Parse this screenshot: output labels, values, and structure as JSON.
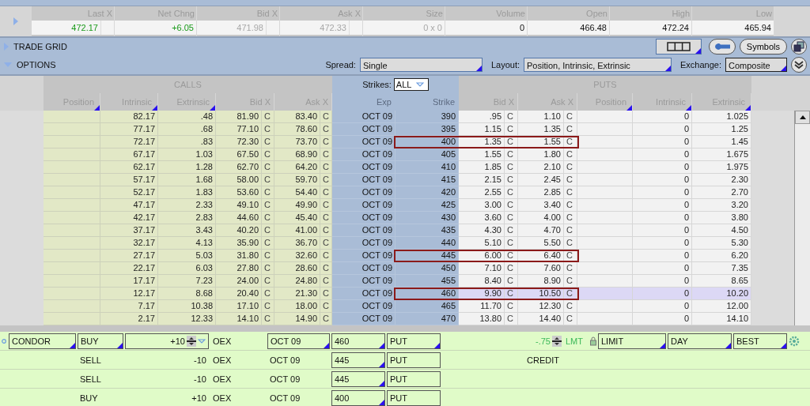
{
  "underlying": {
    "columns": [
      {
        "label": "Last X",
        "value": "472.17",
        "color": "#1a9a1a",
        "exchange_col": true
      },
      {
        "label": "Net Chng",
        "value": "+6.05",
        "color": "#1a9a1a",
        "exchange_col": false
      },
      {
        "label": "Bid X",
        "value": "471.98",
        "color": "#a8a8a8",
        "exchange_col": true
      },
      {
        "label": "Ask X",
        "value": "472.33",
        "color": "#a8a8a8",
        "exchange_col": true
      },
      {
        "label": "Size",
        "value": "0 x 0",
        "color": "#a8a8a8",
        "exchange_col": false
      },
      {
        "label": "Volume",
        "value": "0",
        "exchange_col": false
      },
      {
        "label": "Open",
        "value": "466.48",
        "exchange_col": false
      },
      {
        "label": "High",
        "value": "472.24",
        "exchange_col": false
      },
      {
        "label": "Low",
        "value": "465.94",
        "exchange_col": false
      }
    ]
  },
  "trade_grid": {
    "title": "TRADE GRID",
    "expanded": false,
    "symbols_button": "Symbols"
  },
  "options": {
    "title": "OPTIONS",
    "expanded": true,
    "spread": {
      "label": "Spread:",
      "value": "Single"
    },
    "layout": {
      "label": "Layout:",
      "value": "Position, Intrinsic, Extrinsic"
    },
    "exchange": {
      "label": "Exchange:",
      "value": "Composite"
    },
    "calls_label": "CALLS",
    "puts_label": "PUTS",
    "strikes": {
      "label": "Strikes:",
      "value": "ALL"
    },
    "columns": {
      "call_position": "Position",
      "call_intrinsic": "Intrinsic",
      "call_extrinsic": "Extrinsic",
      "call_bid": "Bid X",
      "call_ask": "Ask X",
      "exp": "Exp",
      "strike": "Strike",
      "put_bid": "Bid X",
      "put_ask": "Ask X",
      "put_position": "Position",
      "put_intrinsic": "Intrinsic",
      "put_extrinsic": "Extrinsic"
    },
    "rows": [
      {
        "call_intrinsic": "82.17",
        "call_extrinsic": ".48",
        "call_bid": "81.90",
        "call_bid_ex": "C",
        "call_ask": "83.40",
        "call_ask_ex": "C",
        "exp": "OCT 09",
        "strike": "390",
        "put_bid": ".95",
        "put_bid_ex": "C",
        "put_ask": "1.10",
        "put_ask_ex": "C",
        "put_intrinsic": "0",
        "put_extrinsic": "1.025",
        "highlighted": false,
        "selected": false
      },
      {
        "call_intrinsic": "77.17",
        "call_extrinsic": ".68",
        "call_bid": "77.10",
        "call_bid_ex": "C",
        "call_ask": "78.60",
        "call_ask_ex": "C",
        "exp": "OCT 09",
        "strike": "395",
        "put_bid": "1.15",
        "put_bid_ex": "C",
        "put_ask": "1.35",
        "put_ask_ex": "C",
        "put_intrinsic": "0",
        "put_extrinsic": "1.25",
        "highlighted": false,
        "selected": false
      },
      {
        "call_intrinsic": "72.17",
        "call_extrinsic": ".83",
        "call_bid": "72.30",
        "call_bid_ex": "C",
        "call_ask": "73.70",
        "call_ask_ex": "C",
        "exp": "OCT 09",
        "strike": "400",
        "put_bid": "1.35",
        "put_bid_ex": "C",
        "put_ask": "1.55",
        "put_ask_ex": "C",
        "put_intrinsic": "0",
        "put_extrinsic": "1.45",
        "highlighted": true,
        "selected": false
      },
      {
        "call_intrinsic": "67.17",
        "call_extrinsic": "1.03",
        "call_bid": "67.50",
        "call_bid_ex": "C",
        "call_ask": "68.90",
        "call_ask_ex": "C",
        "exp": "OCT 09",
        "strike": "405",
        "put_bid": "1.55",
        "put_bid_ex": "C",
        "put_ask": "1.80",
        "put_ask_ex": "C",
        "put_intrinsic": "0",
        "put_extrinsic": "1.675",
        "highlighted": false,
        "selected": false
      },
      {
        "call_intrinsic": "62.17",
        "call_extrinsic": "1.28",
        "call_bid": "62.70",
        "call_bid_ex": "C",
        "call_ask": "64.20",
        "call_ask_ex": "C",
        "exp": "OCT 09",
        "strike": "410",
        "put_bid": "1.85",
        "put_bid_ex": "C",
        "put_ask": "2.10",
        "put_ask_ex": "C",
        "put_intrinsic": "0",
        "put_extrinsic": "1.975",
        "highlighted": false,
        "selected": false
      },
      {
        "call_intrinsic": "57.17",
        "call_extrinsic": "1.68",
        "call_bid": "58.00",
        "call_bid_ex": "C",
        "call_ask": "59.70",
        "call_ask_ex": "C",
        "exp": "OCT 09",
        "strike": "415",
        "put_bid": "2.15",
        "put_bid_ex": "C",
        "put_ask": "2.45",
        "put_ask_ex": "C",
        "put_intrinsic": "0",
        "put_extrinsic": "2.30",
        "highlighted": false,
        "selected": false
      },
      {
        "call_intrinsic": "52.17",
        "call_extrinsic": "1.83",
        "call_bid": "53.60",
        "call_bid_ex": "C",
        "call_ask": "54.40",
        "call_ask_ex": "C",
        "exp": "OCT 09",
        "strike": "420",
        "put_bid": "2.55",
        "put_bid_ex": "C",
        "put_ask": "2.85",
        "put_ask_ex": "C",
        "put_intrinsic": "0",
        "put_extrinsic": "2.70",
        "highlighted": false,
        "selected": false
      },
      {
        "call_intrinsic": "47.17",
        "call_extrinsic": "2.33",
        "call_bid": "49.10",
        "call_bid_ex": "C",
        "call_ask": "49.90",
        "call_ask_ex": "C",
        "exp": "OCT 09",
        "strike": "425",
        "put_bid": "3.00",
        "put_bid_ex": "C",
        "put_ask": "3.40",
        "put_ask_ex": "C",
        "put_intrinsic": "0",
        "put_extrinsic": "3.20",
        "highlighted": false,
        "selected": false
      },
      {
        "call_intrinsic": "42.17",
        "call_extrinsic": "2.83",
        "call_bid": "44.60",
        "call_bid_ex": "C",
        "call_ask": "45.40",
        "call_ask_ex": "C",
        "exp": "OCT 09",
        "strike": "430",
        "put_bid": "3.60",
        "put_bid_ex": "C",
        "put_ask": "4.00",
        "put_ask_ex": "C",
        "put_intrinsic": "0",
        "put_extrinsic": "3.80",
        "highlighted": false,
        "selected": false
      },
      {
        "call_intrinsic": "37.17",
        "call_extrinsic": "3.43",
        "call_bid": "40.20",
        "call_bid_ex": "C",
        "call_ask": "41.00",
        "call_ask_ex": "C",
        "exp": "OCT 09",
        "strike": "435",
        "put_bid": "4.30",
        "put_bid_ex": "C",
        "put_ask": "4.70",
        "put_ask_ex": "C",
        "put_intrinsic": "0",
        "put_extrinsic": "4.50",
        "highlighted": false,
        "selected": false
      },
      {
        "call_intrinsic": "32.17",
        "call_extrinsic": "4.13",
        "call_bid": "35.90",
        "call_bid_ex": "C",
        "call_ask": "36.70",
        "call_ask_ex": "C",
        "exp": "OCT 09",
        "strike": "440",
        "put_bid": "5.10",
        "put_bid_ex": "C",
        "put_ask": "5.50",
        "put_ask_ex": "C",
        "put_intrinsic": "0",
        "put_extrinsic": "5.30",
        "highlighted": false,
        "selected": false
      },
      {
        "call_intrinsic": "27.17",
        "call_extrinsic": "5.03",
        "call_bid": "31.80",
        "call_bid_ex": "C",
        "call_ask": "32.60",
        "call_ask_ex": "C",
        "exp": "OCT 09",
        "strike": "445",
        "put_bid": "6.00",
        "put_bid_ex": "C",
        "put_ask": "6.40",
        "put_ask_ex": "C",
        "put_intrinsic": "0",
        "put_extrinsic": "6.20",
        "highlighted": true,
        "selected": false
      },
      {
        "call_intrinsic": "22.17",
        "call_extrinsic": "6.03",
        "call_bid": "27.80",
        "call_bid_ex": "C",
        "call_ask": "28.60",
        "call_ask_ex": "C",
        "exp": "OCT 09",
        "strike": "450",
        "put_bid": "7.10",
        "put_bid_ex": "C",
        "put_ask": "7.60",
        "put_ask_ex": "C",
        "put_intrinsic": "0",
        "put_extrinsic": "7.35",
        "highlighted": false,
        "selected": false
      },
      {
        "call_intrinsic": "17.17",
        "call_extrinsic": "7.23",
        "call_bid": "24.00",
        "call_bid_ex": "C",
        "call_ask": "24.80",
        "call_ask_ex": "C",
        "exp": "OCT 09",
        "strike": "455",
        "put_bid": "8.40",
        "put_bid_ex": "C",
        "put_ask": "8.90",
        "put_ask_ex": "C",
        "put_intrinsic": "0",
        "put_extrinsic": "8.65",
        "highlighted": false,
        "selected": false
      },
      {
        "call_intrinsic": "12.17",
        "call_extrinsic": "8.68",
        "call_bid": "20.40",
        "call_bid_ex": "C",
        "call_ask": "21.30",
        "call_ask_ex": "C",
        "exp": "OCT 09",
        "strike": "460",
        "put_bid": "9.90",
        "put_bid_ex": "C",
        "put_ask": "10.50",
        "put_ask_ex": "C",
        "put_intrinsic": "0",
        "put_extrinsic": "10.20",
        "highlighted": true,
        "selected": true
      },
      {
        "call_intrinsic": "7.17",
        "call_extrinsic": "10.38",
        "call_bid": "17.10",
        "call_bid_ex": "C",
        "call_ask": "18.00",
        "call_ask_ex": "C",
        "exp": "OCT 09",
        "strike": "465",
        "put_bid": "11.70",
        "put_bid_ex": "C",
        "put_ask": "12.30",
        "put_ask_ex": "C",
        "put_intrinsic": "0",
        "put_extrinsic": "12.00",
        "highlighted": false,
        "selected": false
      },
      {
        "call_intrinsic": "2.17",
        "call_extrinsic": "12.33",
        "call_bid": "14.10",
        "call_bid_ex": "C",
        "call_ask": "14.90",
        "call_ask_ex": "C",
        "exp": "OCT 09",
        "strike": "470",
        "put_bid": "13.80",
        "put_bid_ex": "C",
        "put_ask": "14.40",
        "put_ask_ex": "C",
        "put_intrinsic": "0",
        "put_extrinsic": "14.10",
        "highlighted": false,
        "selected": false
      }
    ]
  },
  "order": {
    "spread": "CONDOR",
    "price": "-.75",
    "price_type": "LMT",
    "credit_label": "CREDIT",
    "order_type": "LIMIT",
    "tif": "DAY",
    "exchange": "BEST",
    "legs": [
      {
        "side": "BUY",
        "qty": "+10",
        "symbol": "OEX",
        "exp": "OCT 09",
        "strike": "460",
        "type": "PUT"
      },
      {
        "side": "SELL",
        "qty": "-10",
        "symbol": "OEX",
        "exp": "OCT 09",
        "strike": "445",
        "type": "PUT"
      },
      {
        "side": "SELL",
        "qty": "-10",
        "symbol": "OEX",
        "exp": "OCT 09",
        "strike": "445",
        "type": "PUT"
      },
      {
        "side": "BUY",
        "qty": "+10",
        "symbol": "OEX",
        "exp": "OCT 09",
        "strike": "400",
        "type": "PUT"
      }
    ]
  }
}
